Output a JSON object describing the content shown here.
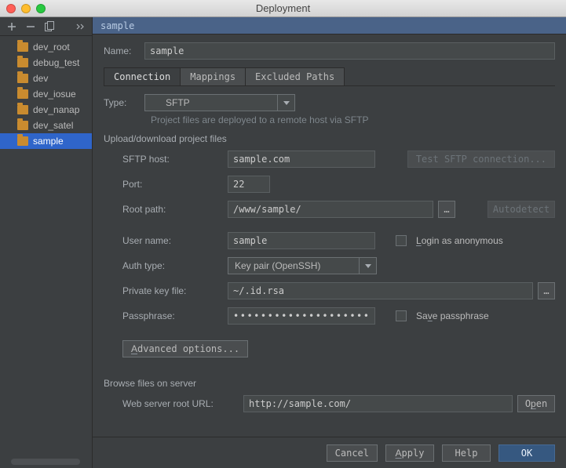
{
  "window": {
    "title": "Deployment"
  },
  "sidebar": {
    "items": [
      {
        "label": "dev_root"
      },
      {
        "label": "debug_test"
      },
      {
        "label": "dev"
      },
      {
        "label": "dev_iosue"
      },
      {
        "label": "dev_nanap"
      },
      {
        "label": "dev_satel"
      },
      {
        "label": "sample"
      }
    ]
  },
  "banner": "sample",
  "form": {
    "name_label": "Name:",
    "name_value": "sample",
    "tabs": {
      "connection": "Connection",
      "mappings": "Mappings",
      "excluded": "Excluded Paths"
    },
    "type_label": "Type:",
    "type_value": "SFTP",
    "hint": "Project files are deployed to a remote host via SFTP",
    "group_upload": "Upload/download project files",
    "host_label": "SFTP host:",
    "host_value": "sample.com",
    "test_btn": "Test SFTP connection...",
    "port_label": "Port:",
    "port_value": "22",
    "root_label": "Root path:",
    "root_value": "/www/sample/",
    "autodetect": "Autodetect",
    "user_label": "User name:",
    "user_value": "sample",
    "anon_label": "Login as anonymous",
    "auth_label": "Auth type:",
    "auth_value": "Key pair (OpenSSH)",
    "pk_label": "Private key file:",
    "pk_value": "~/.id.rsa",
    "pass_label": "Passphrase:",
    "pass_value": "••••••••••••••••••••••••",
    "savepass_label": "Save passphrase",
    "advanced": "Advanced options...",
    "group_browse": "Browse files on server",
    "url_label": "Web server root URL:",
    "url_value": "http://sample.com/",
    "open": "Open"
  },
  "footer": {
    "cancel": "Cancel",
    "apply": "Apply",
    "help": "Help",
    "ok": "OK"
  }
}
